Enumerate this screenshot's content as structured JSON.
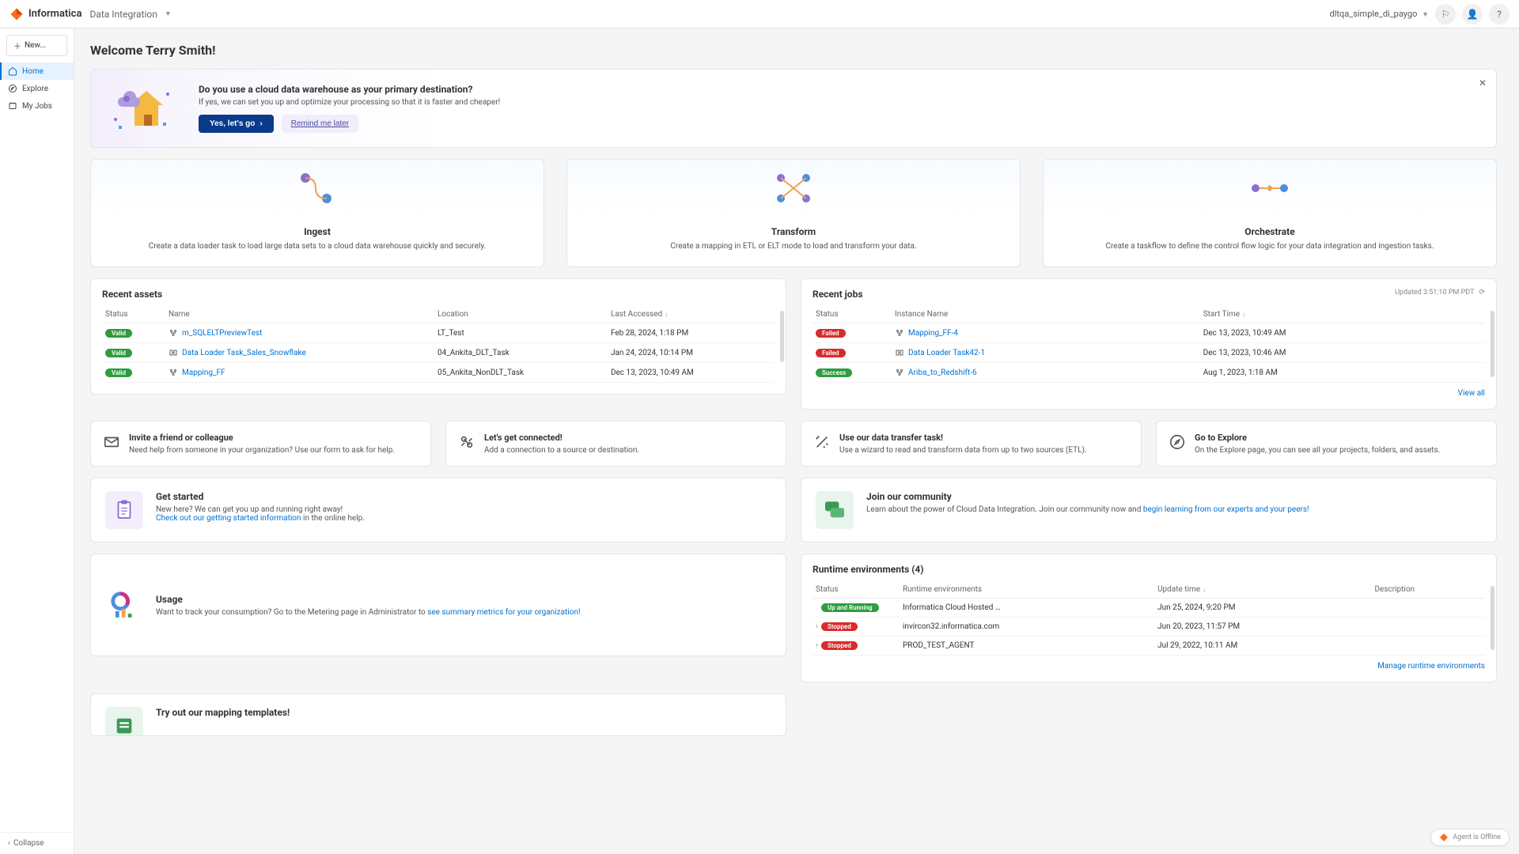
{
  "brand": "Informatica",
  "app_name": "Data Integration",
  "org": "dltqa_simple_di_paygo",
  "sidebar": {
    "new": "New...",
    "items": [
      {
        "label": "Home"
      },
      {
        "label": "Explore"
      },
      {
        "label": "My Jobs"
      }
    ],
    "collapse": "Collapse"
  },
  "welcome": "Welcome Terry Smith!",
  "banner": {
    "title": "Do you use a cloud data warehouse as your primary destination?",
    "sub": "If yes, we can set you up and optimize your processing so that it is faster and cheaper!",
    "yes": "Yes, let's go",
    "remind": "Remind me later"
  },
  "tiles": [
    {
      "title": "Ingest",
      "desc": "Create a data loader task to load large data sets to a cloud data warehouse quickly and securely."
    },
    {
      "title": "Transform",
      "desc": "Create a mapping in ETL or ELT mode to load and transform your data."
    },
    {
      "title": "Orchestrate",
      "desc": "Create a taskflow to define the control flow logic for your data integration and ingestion tasks."
    }
  ],
  "recent_assets": {
    "title": "Recent assets",
    "headers": {
      "status": "Status",
      "name": "Name",
      "location": "Location",
      "accessed": "Last Accessed"
    },
    "rows": [
      {
        "status": "Valid",
        "name": "m_SQLELTPreviewTest",
        "location": "LT_Test",
        "accessed": "Feb 28, 2024, 1:18 PM",
        "icon": "mapping"
      },
      {
        "status": "Valid",
        "name": "Data Loader Task_Sales_Snowflake",
        "location": "04_Ankita_DLT_Task",
        "accessed": "Jan 24, 2024, 10:14 PM",
        "icon": "loader"
      },
      {
        "status": "Valid",
        "name": "Mapping_FF",
        "location": "05_Ankita_NonDLT_Task",
        "accessed": "Dec 13, 2023, 10:49 AM",
        "icon": "mapping"
      }
    ]
  },
  "recent_jobs": {
    "title": "Recent jobs",
    "updated": "Updated 3:51:10 PM PDT",
    "headers": {
      "status": "Status",
      "instance": "Instance Name",
      "start": "Start Time"
    },
    "view_all": "View all",
    "rows": [
      {
        "status": "Failed",
        "badge": "failed",
        "instance": "Mapping_FF-4",
        "start": "Dec 13, 2023, 10:49 AM",
        "icon": "mapping"
      },
      {
        "status": "Failed",
        "badge": "failed",
        "instance": "Data Loader Task42-1",
        "start": "Dec 13, 2023, 10:46 AM",
        "icon": "loader"
      },
      {
        "status": "Success",
        "badge": "success",
        "instance": "Ariba_to_Redshift-6",
        "start": "Aug 1, 2023, 1:18 AM",
        "icon": "mapping"
      }
    ]
  },
  "quad": [
    {
      "title": "Invite a friend or colleague",
      "desc": "Need help from someone in your organization? Use our form to ask for help."
    },
    {
      "title": "Let's get connected!",
      "desc": "Add a connection to a source or destination."
    },
    {
      "title": "Use our data transfer task!",
      "desc": "Use a wizard to read and transform data from up to two sources (ETL)."
    },
    {
      "title": "Go to Explore",
      "desc": "On the Explore page, you can see all your projects, folders, and assets."
    }
  ],
  "get_started": {
    "title": "Get started",
    "line1": "New here? We can get you up and running right away!",
    "link": "Check out our getting started information",
    "line2": " in the online help."
  },
  "community": {
    "title": "Join our community",
    "line1": "Learn about the power of Cloud Data Integration. Join our community now and ",
    "link": "begin learning from our experts and your peers!"
  },
  "usage": {
    "title": "Usage",
    "line1": "Want to track your consumption? Go to the Metering page in Administrator to ",
    "link": "see summary metrics for your organization!"
  },
  "runtime": {
    "title": "Runtime environments (4)",
    "headers": {
      "status": "Status",
      "env": "Runtime environments",
      "updated": "Update time",
      "desc": "Description"
    },
    "manage": "Manage runtime environments",
    "rows": [
      {
        "status": "Up and Running",
        "badge": "running",
        "env": "Informatica Cloud Hosted …",
        "updated": "Jun 25, 2024, 9:20 PM",
        "desc": "",
        "expand": false
      },
      {
        "status": "Stopped",
        "badge": "stopped",
        "env": "invircon32.informatica.com",
        "updated": "Jun 20, 2023, 11:57 PM",
        "desc": "",
        "expand": true
      },
      {
        "status": "Stopped",
        "badge": "stopped",
        "env": "PROD_TEST_AGENT",
        "updated": "Jul 29, 2022, 10:11 AM",
        "desc": "",
        "expand": true
      }
    ]
  },
  "templates": {
    "title": "Try out our mapping templates!"
  },
  "agent": "Agent is Offline"
}
